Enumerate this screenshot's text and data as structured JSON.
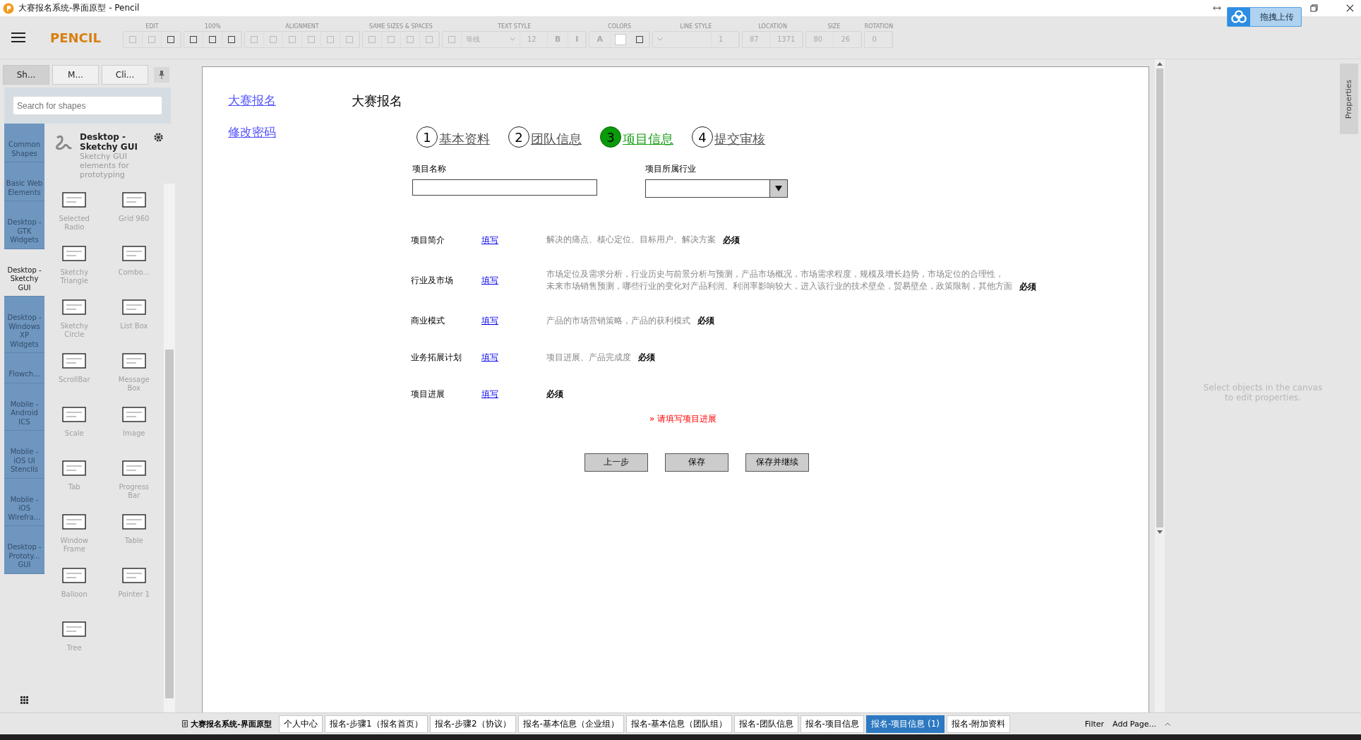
{
  "window": {
    "title": "大赛报名系统-界面原型 - Pencil",
    "upload_widget": "拖拽上传"
  },
  "app": {
    "logo": "PENCIL"
  },
  "toolbar": {
    "groups": [
      {
        "label": "EDIT",
        "items": [
          {
            "kind": "icon",
            "disabled": true
          },
          {
            "kind": "icon",
            "disabled": true
          },
          {
            "kind": "icon",
            "disabled": false
          }
        ]
      },
      {
        "label": "100%",
        "items": [
          {
            "kind": "icon",
            "disabled": false
          },
          {
            "kind": "icon",
            "disabled": false
          },
          {
            "kind": "icon",
            "disabled": false
          }
        ]
      },
      {
        "label": "ALIGNMENT",
        "items": [
          {
            "kind": "icon",
            "disabled": true
          },
          {
            "kind": "icon",
            "disabled": true
          },
          {
            "kind": "icon",
            "disabled": true
          },
          {
            "kind": "icon",
            "disabled": true
          },
          {
            "kind": "icon",
            "disabled": true
          },
          {
            "kind": "icon",
            "disabled": true
          }
        ]
      },
      {
        "label": "SAME SIZES & SPACES",
        "items": [
          {
            "kind": "icon",
            "disabled": true
          },
          {
            "kind": "icon",
            "disabled": true
          },
          {
            "kind": "icon",
            "disabled": true
          },
          {
            "kind": "icon",
            "disabled": true
          }
        ]
      },
      {
        "label": "TEXT STYLE",
        "items": [
          {
            "kind": "icon",
            "disabled": true
          },
          {
            "kind": "dropdown",
            "text": "等线"
          },
          {
            "kind": "value",
            "text": "12"
          },
          {
            "kind": "text",
            "text": "B"
          },
          {
            "kind": "text",
            "text": "I"
          }
        ]
      },
      {
        "label": "COLORS",
        "items": [
          {
            "kind": "text",
            "text": "A"
          },
          {
            "kind": "swatch"
          },
          {
            "kind": "icon",
            "disabled": false
          }
        ]
      },
      {
        "label": "LINE STYLE",
        "items": [
          {
            "kind": "dropdown"
          },
          {
            "kind": "value",
            "text": "1"
          }
        ]
      },
      {
        "label": "LOCATION",
        "items": [
          {
            "kind": "value",
            "text": "87"
          },
          {
            "kind": "value",
            "text": "1371"
          }
        ]
      },
      {
        "label": "SIZE",
        "items": [
          {
            "kind": "value",
            "text": "80"
          },
          {
            "kind": "value",
            "text": "26"
          }
        ]
      },
      {
        "label": "ROTATION",
        "items": [
          {
            "kind": "value",
            "text": "0"
          }
        ]
      }
    ]
  },
  "left_panel": {
    "tabs": [
      {
        "label": "Sh...",
        "selected": true
      },
      {
        "label": "M...",
        "selected": false
      },
      {
        "label": "Cli...",
        "selected": false
      }
    ],
    "search": {
      "placeholder": "Search for shapes"
    },
    "categories": [
      {
        "label": "Common Shapes",
        "selected": false
      },
      {
        "label": "Basic Web Elements",
        "selected": false
      },
      {
        "label": "Desktop - GTK Widgets",
        "selected": false
      },
      {
        "label": "Desktop - Sketchy GUI",
        "selected": true
      },
      {
        "label": "Desktop - Windows XP Widgets",
        "selected": false
      },
      {
        "label": "Flowch...",
        "selected": false
      },
      {
        "label": "Mobile - Android ICS",
        "selected": false
      },
      {
        "label": "Mobile - iOS UI Stencils",
        "selected": false
      },
      {
        "label": "Mobile - iOS Wirefra...",
        "selected": false
      },
      {
        "label": "Desktop - Prototy... GUI",
        "selected": false
      }
    ],
    "collection": {
      "title": "Desktop - Sketchy GUI",
      "description": "Sketchy GUI elements for prototyping"
    },
    "shapes": [
      "Selected Radio",
      "Grid 960",
      "Sketchy Triangle",
      "Combo...",
      "Sketchy Circle",
      "List Box",
      "ScrollBar",
      "Message Box",
      "Scale",
      "Image",
      "Tab",
      "Progress Bar",
      "Window Frame",
      "Table",
      "Balloon",
      "Pointer 1",
      "Tree"
    ]
  },
  "canvas": {
    "nav_links": [
      "大赛报名",
      "修改密码"
    ],
    "heading": "大赛报名",
    "steps": [
      {
        "number": "1",
        "label": "基本资料",
        "selected": false
      },
      {
        "number": "2",
        "label": "团队信息",
        "selected": false
      },
      {
        "number": "3",
        "label": "项目信息",
        "selected": true
      },
      {
        "number": "4",
        "label": "提交审核",
        "selected": false
      }
    ],
    "fields": [
      {
        "kind": "text",
        "label": "项目名称"
      },
      {
        "kind": "dropdown",
        "label": "项目所属行业"
      }
    ],
    "rows": [
      {
        "label": "项目简介",
        "link": "填写",
        "hint": [
          "解决的痛点、核心定位、目标用户、解决方案"
        ],
        "required": "必须"
      },
      {
        "label": "行业及市场",
        "link": "填写",
        "hint": [
          "市场定位及需求分析，行业历史与前景分析与预测，产品市场概况，市场需求程度，规模及增长趋势，市场定位的合理性，",
          "未来市场销售预测，哪些行业的变化对产品利润、利润率影响较大，进入该行业的技术壁垒，贸易壁垒，政策限制，其他方面"
        ],
        "required": "必须"
      },
      {
        "label": "商业模式",
        "link": "填写",
        "hint": [
          "产品的市场营销策略，产品的获利模式"
        ],
        "required": "必须"
      },
      {
        "label": "业务拓展计划",
        "link": "填写",
        "hint": [
          "项目进展、产品完成度"
        ],
        "required": "必须"
      },
      {
        "label": "项目进展",
        "link": "填写",
        "required": "必须"
      }
    ],
    "error": "» 请填写项目进展",
    "buttons": [
      "上一步",
      "保存",
      "保存并继续"
    ]
  },
  "right_panel": {
    "tab": "Properties",
    "message": "Select objects in the canvas to edit properties."
  },
  "page_tabs": {
    "document": "大赛报名系统-界面原型",
    "pages": [
      {
        "label": "个人中心",
        "selected": false
      },
      {
        "label": "报名-步骤1（报名首页）",
        "selected": false
      },
      {
        "label": "报名-步骤2（协议）",
        "selected": false
      },
      {
        "label": "报名-基本信息（企业组）",
        "selected": false
      },
      {
        "label": "报名-基本信息（团队组）",
        "selected": false
      },
      {
        "label": "报名-团队信息",
        "selected": false
      },
      {
        "label": "报名-项目信息",
        "selected": false
      },
      {
        "label": "报名-项目信息 (1)",
        "selected": true
      },
      {
        "label": "报名-附加资料",
        "selected": false
      }
    ],
    "filter": "Filter",
    "add_page": "Add Page..."
  }
}
